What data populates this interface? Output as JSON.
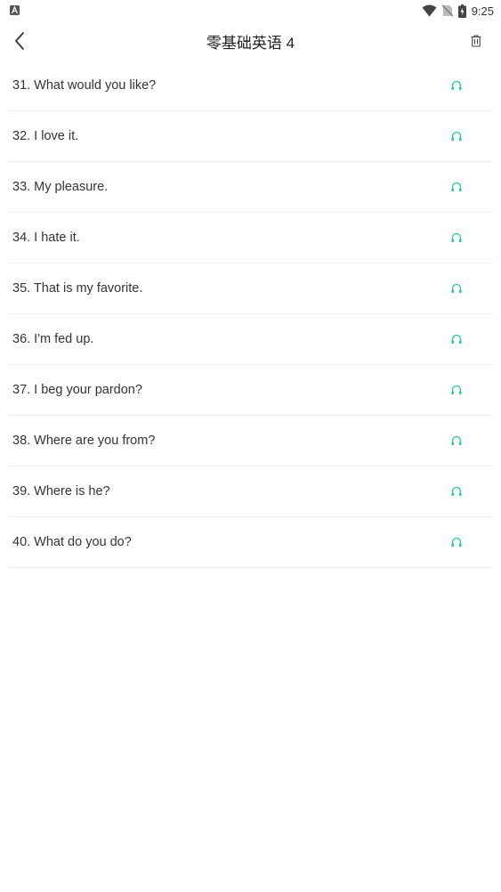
{
  "status_bar": {
    "time": "9:25",
    "left_icon": "a-notification-icon",
    "icons": [
      "wifi-icon",
      "no-sim-icon",
      "battery-charging-icon"
    ]
  },
  "header": {
    "title": "零基础英语 4",
    "back_icon": "chevron-left-icon",
    "action_icon": "trash-icon"
  },
  "colors": {
    "accent": "#26c6a5",
    "text": "#333333",
    "divider": "#eeeeee"
  },
  "sentences": [
    {
      "text": "31. What would you like?",
      "icon": "headphones-icon"
    },
    {
      "text": "32. I love it.",
      "icon": "headphones-icon"
    },
    {
      "text": "33. My pleasure.",
      "icon": "headphones-icon"
    },
    {
      "text": "34. I hate it.",
      "icon": "headphones-icon"
    },
    {
      "text": "35. That is my favorite.",
      "icon": "headphones-icon"
    },
    {
      "text": "36. I'm fed up.",
      "icon": "headphones-icon"
    },
    {
      "text": "37. I beg your pardon?",
      "icon": "headphones-icon"
    },
    {
      "text": "38. Where are you from?",
      "icon": "headphones-icon"
    },
    {
      "text": "39. Where is he?",
      "icon": "headphones-icon"
    },
    {
      "text": "40. What do you do?",
      "icon": "headphones-icon"
    }
  ]
}
